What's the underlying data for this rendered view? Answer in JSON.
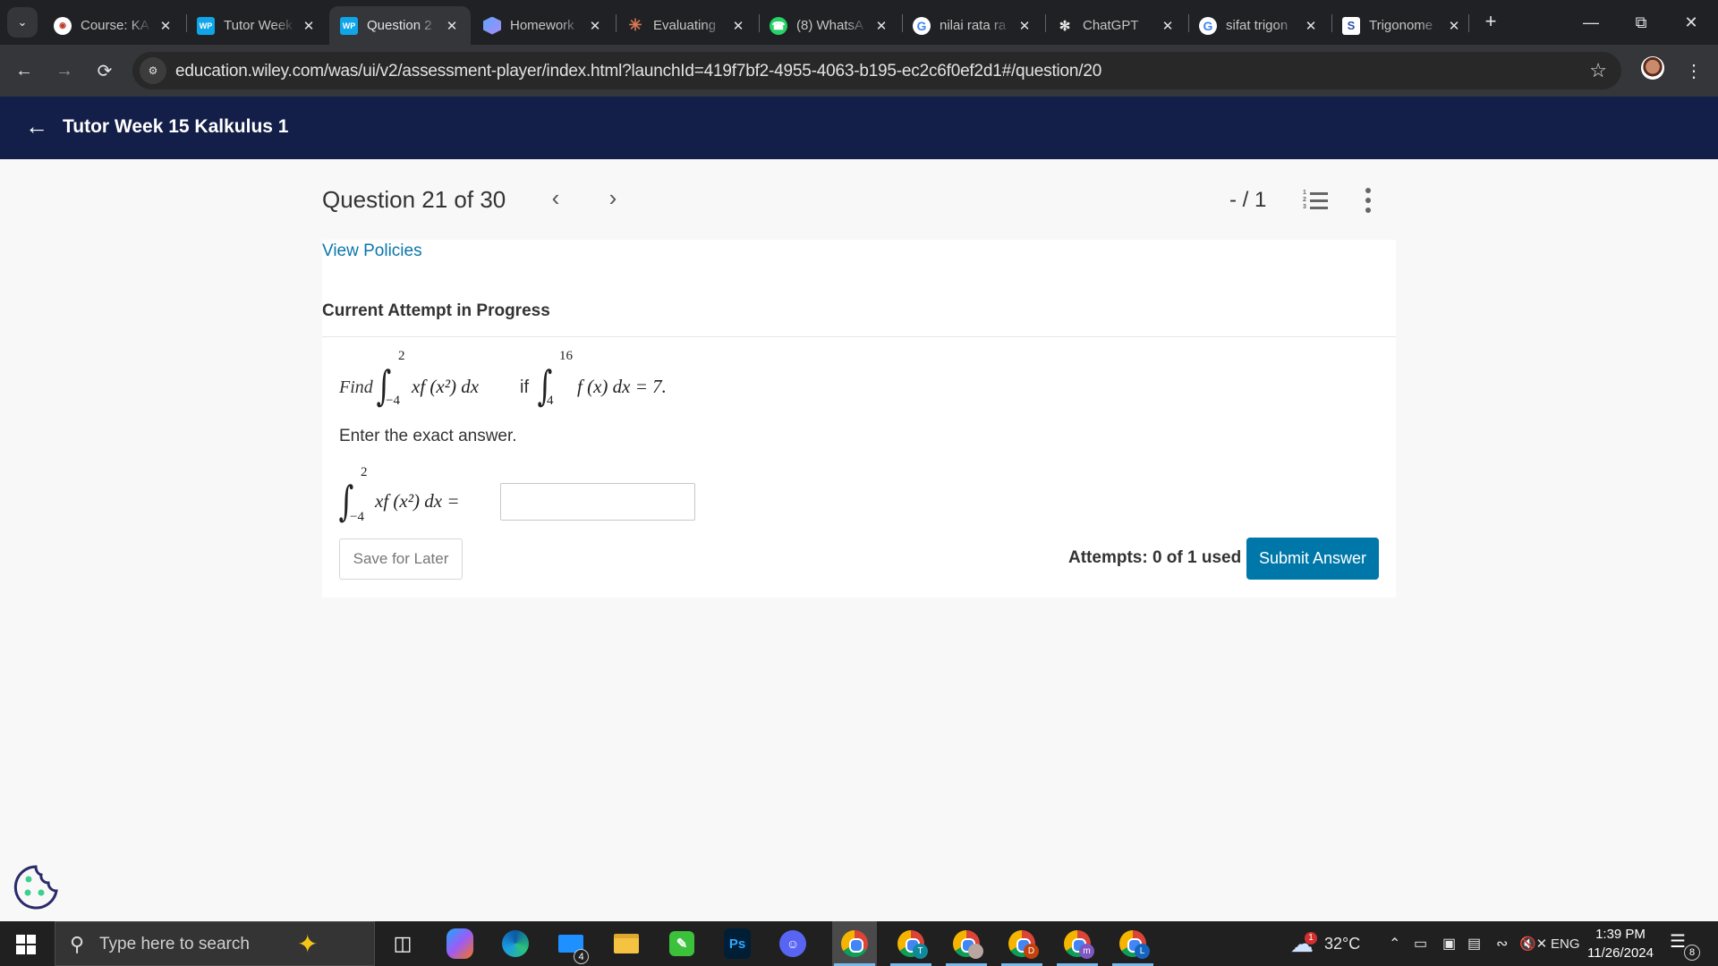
{
  "browser": {
    "tabs": [
      {
        "title": "Course: KA",
        "favicon": "course-icon",
        "color": "#c0392b",
        "active": false
      },
      {
        "title": "Tutor Week",
        "favicon": "wp-icon",
        "color": "#0ea5e9",
        "active": false
      },
      {
        "title": "Question 2",
        "favicon": "wp-icon",
        "color": "#0ea5e9",
        "active": true
      },
      {
        "title": "Homework",
        "favicon": "hexagon-icon",
        "color": "#8b5cf6",
        "active": false
      },
      {
        "title": "Evaluating",
        "favicon": "claude-icon",
        "color": "#d97757",
        "active": false
      },
      {
        "title": "(8) WhatsA",
        "favicon": "whatsapp-icon",
        "color": "#25d366",
        "active": false
      },
      {
        "title": "nilai rata ra",
        "favicon": "google-icon",
        "color": "#4285f4",
        "active": false
      },
      {
        "title": "ChatGPT",
        "favicon": "chatgpt-icon",
        "color": "#202124",
        "active": false
      },
      {
        "title": "sifat trigon",
        "favicon": "google-icon",
        "color": "#4285f4",
        "active": false
      },
      {
        "title": "Trigonome",
        "favicon": "s-icon",
        "color": "#ffffff",
        "active": false
      }
    ],
    "wp_label": "WP",
    "s_label": "S",
    "url": "education.wiley.com/was/ui/v2/assessment-player/index.html?launchId=419f7bf2-4955-4063-b195-ec2c6f0ef2d1#/question/20"
  },
  "app": {
    "title": "Tutor Week 15 Kalkulus 1"
  },
  "question_bar": {
    "counter": "Question 21 of 30",
    "prev": "‹",
    "next": "›",
    "score": "- / 1"
  },
  "card": {
    "view_policies": "View Policies",
    "attempt_heading": "Current Attempt in Progress",
    "question": {
      "prefix": "Find",
      "integral1": {
        "lower": "−4",
        "upper": "2",
        "integrand": "xf (x²) dx"
      },
      "connector": "if",
      "integral2": {
        "lower": "4",
        "upper": "16",
        "integrand": "f (x) dx = 7."
      }
    },
    "instruction": "Enter the exact answer.",
    "answer": {
      "lower": "−4",
      "upper": "2",
      "integrand": "xf (x²) dx =",
      "value": "",
      "placeholder": ""
    },
    "save_label": "Save for Later",
    "attempts_text": "Attempts: 0 of 1 used",
    "submit_label": "Submit Answer",
    "accent_color": "#0077a9"
  },
  "taskbar": {
    "search_placeholder": "Type here to search",
    "mail_badge": "4",
    "photoshop_label": "Ps",
    "chrome_profiles": [
      "",
      "T",
      "",
      "D",
      "m",
      "L"
    ],
    "weather": {
      "temp": "32°C",
      "badge": "1"
    },
    "language": "ENG",
    "time": "1:39 PM",
    "date": "11/26/2024",
    "notification_count": "8"
  }
}
